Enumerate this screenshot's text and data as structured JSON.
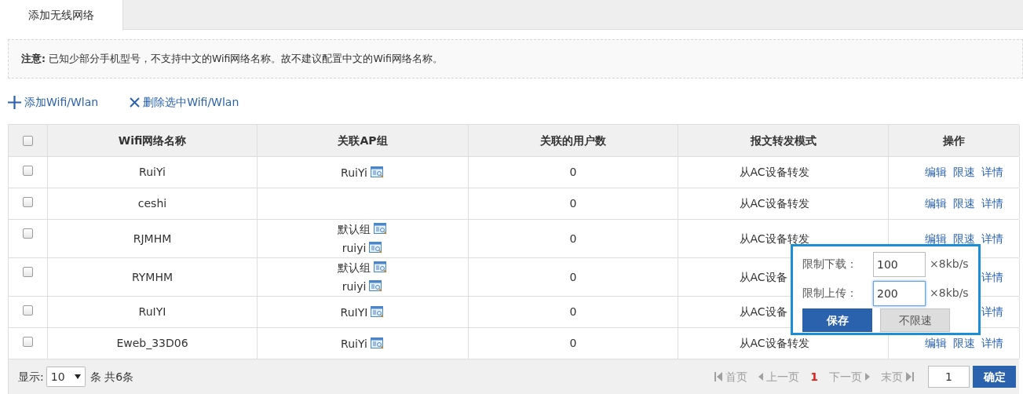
{
  "tabs": [
    {
      "label": "添加无线网络",
      "selected": true
    }
  ],
  "notice": "**注意:** 已知少部分手机型号，不支持中文的Wifi网络名称。故不建议配置中文的Wifi网络名称。",
  "toolbar": [
    {
      "kind": "add",
      "label": "添加Wifi/Wlan"
    },
    {
      "kind": "delete",
      "label": "删除选中Wifi/Wlan"
    }
  ],
  "table": {
    "select_all_checked": false,
    "columns": [
      "Wifi网络名称",
      "关联AP组",
      "关联的用户数",
      "报文转发模式",
      "操作"
    ],
    "rows": [
      {
        "checked": false,
        "name": "RuiYi",
        "ap_groups": [
          "RuiYi"
        ],
        "users": "0",
        "mode": "从AC设备转发",
        "actions": [
          "编辑",
          "限速",
          "详情"
        ]
      },
      {
        "checked": false,
        "name": "ceshi",
        "ap_groups": [],
        "users": "0",
        "mode": "从AC设备转发",
        "actions": [
          "编辑",
          "限速",
          "详情"
        ]
      },
      {
        "checked": false,
        "name": "RJMHM",
        "ap_groups": [
          "默认组",
          "ruiyi"
        ],
        "users": "0",
        "mode": "从AC设备转发",
        "actions": [
          "编辑",
          "限速",
          "详情"
        ]
      },
      {
        "checked": false,
        "name": "RYMHM",
        "ap_groups": [
          "默认组",
          "ruiyi"
        ],
        "users": "0",
        "mode": "从AC设备",
        "actions": [
          "详情"
        ]
      },
      {
        "checked": false,
        "name": "RuIYI",
        "ap_groups": [
          "RuIYI"
        ],
        "users": "0",
        "mode": "从AC设备",
        "actions": [
          "详情"
        ]
      },
      {
        "checked": false,
        "name": "Eweb_33D06",
        "ap_groups": [
          "RuiYi"
        ],
        "users": "0",
        "mode": "从AC设备转发",
        "actions": [
          "编辑",
          "限速",
          "详情"
        ]
      }
    ]
  },
  "rate_popup": {
    "fields": [
      {
        "label": "限制下载：",
        "value": "100",
        "unit": "×8kb/s",
        "focused": false
      },
      {
        "label": "限制上传：",
        "value": "200",
        "unit": "×8kb/s",
        "focused": true
      }
    ],
    "buttons": [
      {
        "kind": "primary",
        "label": "保存"
      },
      {
        "kind": "secondary",
        "label": "不限速"
      }
    ]
  },
  "pagination": {
    "show_label": "显示:",
    "page_size": "10",
    "per_label": "条 共6条",
    "first": "首页",
    "prev": "上一页",
    "current": "1",
    "next": "下一页",
    "last": "末页",
    "goto_value": "1",
    "confirm": "确定"
  }
}
